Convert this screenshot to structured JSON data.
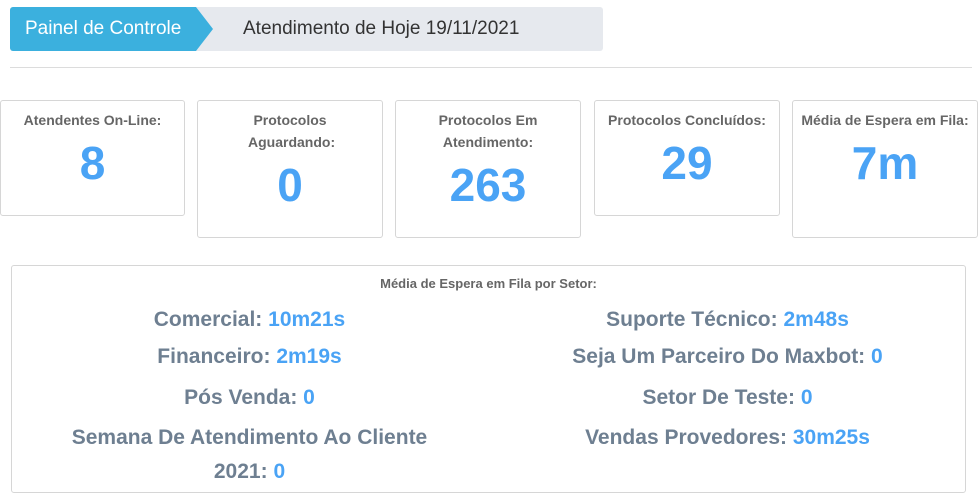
{
  "breadcrumb": {
    "home": "Painel de Controle",
    "current": "Atendimento de Hoje 19/11/2021"
  },
  "cards": [
    {
      "label": "Atendentes On-Line:",
      "value": "8"
    },
    {
      "label": "Protocolos Aguardando:",
      "value": "0"
    },
    {
      "label": "Protocolos Em Atendimento:",
      "value": "263"
    },
    {
      "label": "Protocolos Concluídos:",
      "value": "29"
    },
    {
      "label": "Média de Espera em Fila:",
      "value": "7m"
    }
  ],
  "sectors_panel": {
    "title": "Média de Espera em Fila por Setor:",
    "left": [
      {
        "name": "Comercial:",
        "value": "10m21s"
      },
      {
        "name": "Financeiro:",
        "value": "2m19s"
      },
      {
        "name": "Pós Venda:",
        "value": "0"
      },
      {
        "name": "Semana De Atendimento Ao Cliente 2021:",
        "value": "0"
      }
    ],
    "right": [
      {
        "name": "Suporte Técnico:",
        "value": "2m48s"
      },
      {
        "name": "Seja Um Parceiro Do Maxbot:",
        "value": "0"
      },
      {
        "name": "Setor De Teste:",
        "value": "0"
      },
      {
        "name": "Vendas Provedores:",
        "value": "30m25s"
      }
    ]
  },
  "colors": {
    "accent": "#3bb0de",
    "value": "#4aa3f5",
    "sector_name": "#6e7f91"
  }
}
